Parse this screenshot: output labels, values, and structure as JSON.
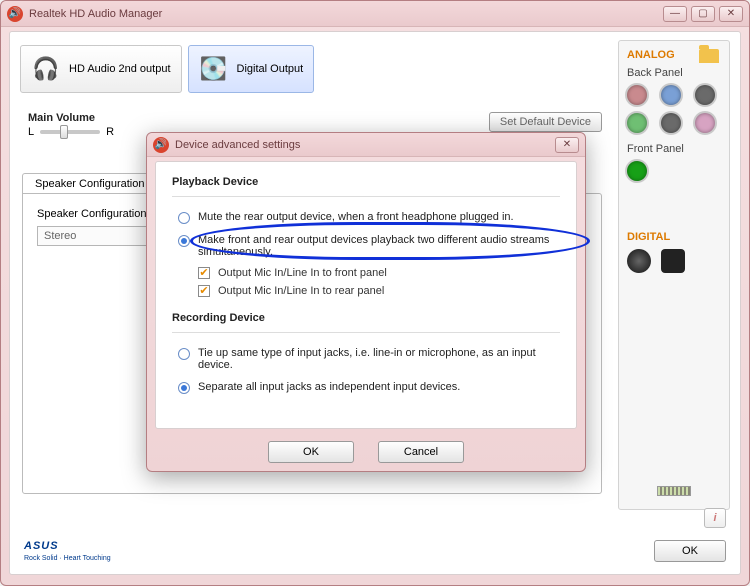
{
  "window": {
    "title": "Realtek HD Audio Manager",
    "min": "—",
    "max": "▢",
    "close": "✕"
  },
  "tabs": {
    "hd2": "HD Audio 2nd output",
    "digital": "Digital Output"
  },
  "adv_link": "Device advanced settings",
  "volume": {
    "label": "Main Volume",
    "left": "L",
    "right": "R",
    "default_btn": "Set Default Device"
  },
  "speaker": {
    "tab": "Speaker Configuration",
    "field": "Speaker Configuration",
    "value": "Stereo"
  },
  "right": {
    "analog": "ANALOG",
    "back": "Back Panel",
    "front": "Front Panel",
    "digital": "DIGITAL",
    "jack_colors": [
      "#c98a8e",
      "#7aa0d6",
      "#6a6a6a",
      "#6fbf73",
      "#6a6a6a",
      "#d7a3c2"
    ],
    "front_color": "#17a017"
  },
  "dialog": {
    "title": "Device advanced settings",
    "close": "✕",
    "playback": {
      "heading": "Playback Device",
      "opt1": "Mute the rear output device, when a front headphone plugged in.",
      "opt2": "Make front and rear output devices playback two different audio streams simultaneously.",
      "cb1": "Output Mic In/Line In to front panel",
      "cb2": "Output Mic In/Line In to rear panel"
    },
    "recording": {
      "heading": "Recording Device",
      "opt1": "Tie up same type of input jacks, i.e. line-in or microphone, as an input device.",
      "opt2": "Separate all input jacks as independent input devices."
    },
    "ok": "OK",
    "cancel": "Cancel"
  },
  "footer": {
    "brand": "ASUS",
    "slogan": "Rock Solid · Heart Touching",
    "ok": "OK"
  }
}
